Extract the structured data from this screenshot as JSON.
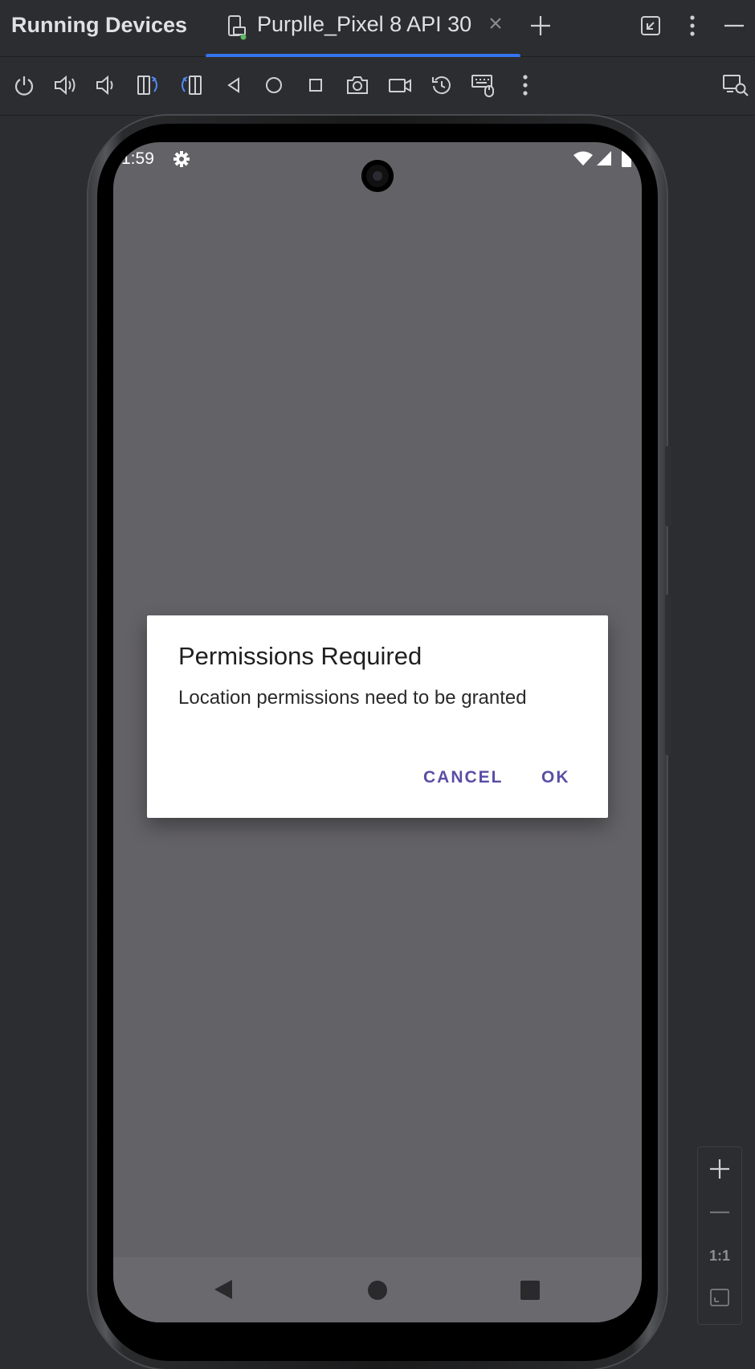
{
  "panel": {
    "title": "Running Devices"
  },
  "tab": {
    "label": "Purplle_Pixel 8 API 30",
    "close_icon": "close-icon",
    "accent": "#3574f0"
  },
  "titlebar_actions": [
    "new-tab-icon",
    "restore-icon",
    "more-vert-icon",
    "minimize-icon"
  ],
  "toolbar": {
    "icons": [
      "power-icon",
      "volume-up-icon",
      "volume-down-icon",
      "rotate-left-icon",
      "rotate-right-icon",
      "back-icon",
      "home-icon",
      "overview-icon",
      "screenshot-icon",
      "screen-record-icon",
      "snapshot-restore-icon",
      "keyboard-mouse-icon",
      "more-vert-icon"
    ],
    "right_icon": "device-search-icon"
  },
  "device": {
    "status_time": "1:59",
    "status_icons": [
      "settings-icon",
      "wifi-icon",
      "signal-icon",
      "battery-icon"
    ],
    "nav_icons": [
      "nav-back-icon",
      "nav-home-icon",
      "nav-recents-icon"
    ]
  },
  "dialog": {
    "title": "Permissions Required",
    "message": "Location permissions need to be granted",
    "cancel_label": "CANCEL",
    "ok_label": "OK",
    "button_color": "#5a4ea6"
  },
  "zoom": {
    "actual_size_label": "1:1",
    "icons": [
      "zoom-in-icon",
      "zoom-out-icon",
      "fit-screen-icon"
    ]
  }
}
